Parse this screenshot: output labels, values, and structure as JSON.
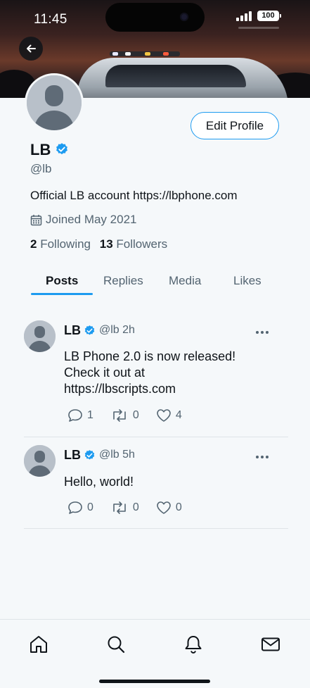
{
  "status_bar": {
    "time": "11:45",
    "battery": "100"
  },
  "profile": {
    "name": "LB",
    "handle": "@lb",
    "bio": "Official LB account https://lbphone.com",
    "joined": "Joined May 2021",
    "following_count": "2",
    "following_label": "Following",
    "followers_count": "13",
    "followers_label": "Followers",
    "edit_button": "Edit Profile"
  },
  "tabs": [
    {
      "label": "Posts",
      "active": true
    },
    {
      "label": "Replies",
      "active": false
    },
    {
      "label": "Media",
      "active": false
    },
    {
      "label": "Likes",
      "active": false
    }
  ],
  "posts": [
    {
      "name": "LB",
      "handle": "@lb",
      "time": "2h",
      "text_lines": [
        "LB Phone 2.0 is now released!",
        "Check it out at",
        "https://lbscripts.com"
      ],
      "replies": "1",
      "reposts": "0",
      "likes": "4"
    },
    {
      "name": "LB",
      "handle": "@lb",
      "time": "5h",
      "text_lines": [
        "Hello, world!"
      ],
      "replies": "0",
      "reposts": "0",
      "likes": "0"
    }
  ],
  "icons": {
    "back": "arrow-left-icon",
    "verified": "verified-badge-icon",
    "calendar": "calendar-icon",
    "more": "more-horizontal-icon",
    "reply": "comment-icon",
    "repost": "repost-icon",
    "like": "heart-icon",
    "nav_home": "home-icon",
    "nav_search": "search-icon",
    "nav_notifications": "bell-icon",
    "nav_messages": "mail-icon"
  },
  "colors": {
    "accent": "#1d9bf0",
    "text": "#0f1419",
    "muted": "#536471",
    "background": "#f5f8fa"
  }
}
